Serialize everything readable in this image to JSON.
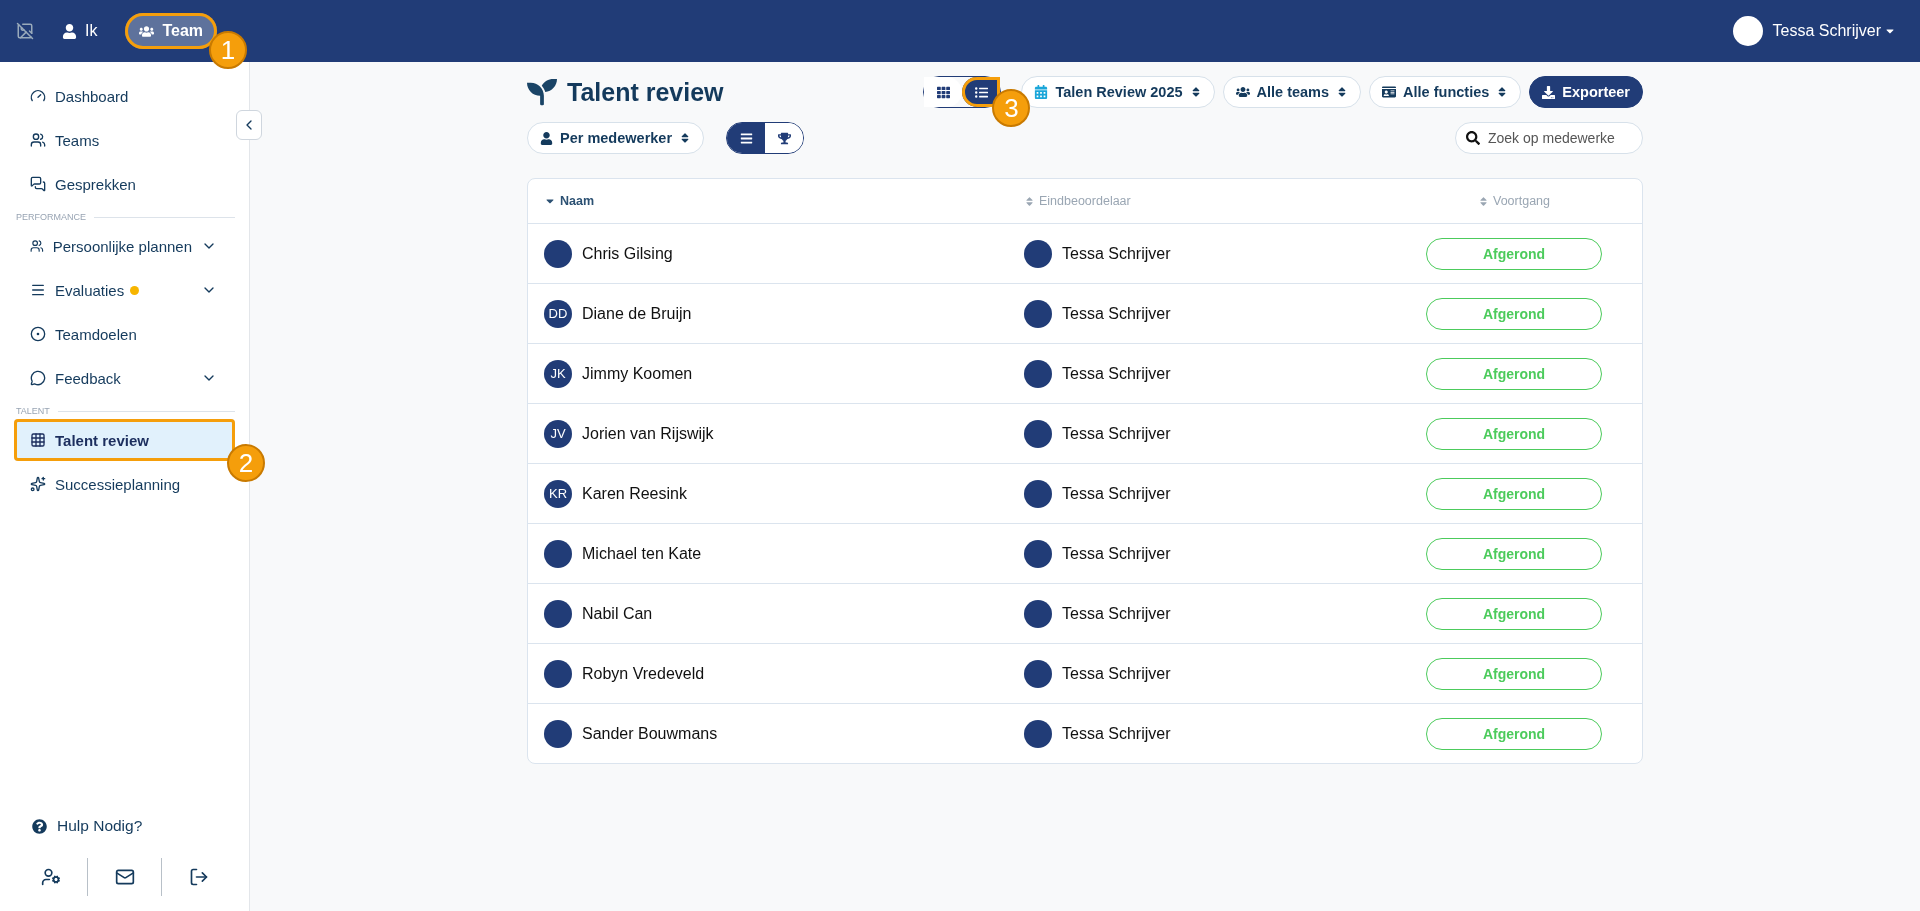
{
  "topbar": {
    "nav": [
      {
        "label": "Ik",
        "selected": false
      },
      {
        "label": "Team",
        "selected": true,
        "callout": "1"
      }
    ],
    "user": {
      "name": "Tessa Schrijver"
    }
  },
  "sidebar": {
    "sections": [
      {
        "items": [
          {
            "label": "Dashboard",
            "selected": false
          },
          {
            "label": "Teams",
            "selected": false
          },
          {
            "label": "Gesprekken",
            "selected": false
          }
        ]
      },
      {
        "title": "PERFORMANCE",
        "items": [
          {
            "label": "Persoonlijke plannen",
            "selected": false,
            "expandable": true
          },
          {
            "label": "Evaluaties",
            "selected": false,
            "expandable": true,
            "dot": true
          },
          {
            "label": "Teamdoelen",
            "selected": false
          },
          {
            "label": "Feedback",
            "selected": false,
            "expandable": true
          }
        ]
      },
      {
        "title": "TALENT",
        "items": [
          {
            "label": "Talent review",
            "selected": true,
            "callout": "2"
          },
          {
            "label": "Successieplanning",
            "selected": false
          }
        ]
      }
    ],
    "help": "Hulp Nodig?"
  },
  "page": {
    "title": "Talent review",
    "view_toggle": [
      {
        "selected": false
      },
      {
        "selected": true,
        "callout": "3"
      }
    ],
    "filters": [
      {
        "label": "Talen Review 2025"
      },
      {
        "label": "Alle teams"
      },
      {
        "label": "Alle functies"
      }
    ],
    "export": "Exporteer",
    "group_by": "Per medewerker",
    "mode_toggle": [
      {
        "selected": true
      },
      {
        "selected": false
      }
    ],
    "search": {
      "placeholder": "Zoek op medewerke"
    }
  },
  "table": {
    "columns": [
      {
        "label": "Naam",
        "sorted": true
      },
      {
        "label": "Eindbeoordelaar",
        "sorted": false
      },
      {
        "label": "Voortgang",
        "sorted": false
      }
    ],
    "rows": [
      {
        "name": "Chris Gilsing",
        "reviewer": "Tessa Schrijver",
        "status": "Afgerond"
      },
      {
        "name": "Diane de Bruijn",
        "initials": "DD",
        "reviewer": "Tessa Schrijver",
        "status": "Afgerond"
      },
      {
        "name": "Jimmy Koomen",
        "initials": "JK",
        "reviewer": "Tessa Schrijver",
        "status": "Afgerond"
      },
      {
        "name": "Jorien van Rijswijk",
        "initials": "JV",
        "reviewer": "Tessa Schrijver",
        "status": "Afgerond"
      },
      {
        "name": "Karen Reesink",
        "initials": "KR",
        "reviewer": "Tessa Schrijver",
        "status": "Afgerond"
      },
      {
        "name": "Michael ten Kate",
        "reviewer": "Tessa Schrijver",
        "status": "Afgerond"
      },
      {
        "name": "Nabil Can",
        "reviewer": "Tessa Schrijver",
        "status": "Afgerond"
      },
      {
        "name": "Robyn Vredeveld",
        "reviewer": "Tessa Schrijver",
        "status": "Afgerond"
      },
      {
        "name": "Sander Bouwmans",
        "reviewer": "Tessa Schrijver",
        "status": "Afgerond"
      }
    ]
  }
}
